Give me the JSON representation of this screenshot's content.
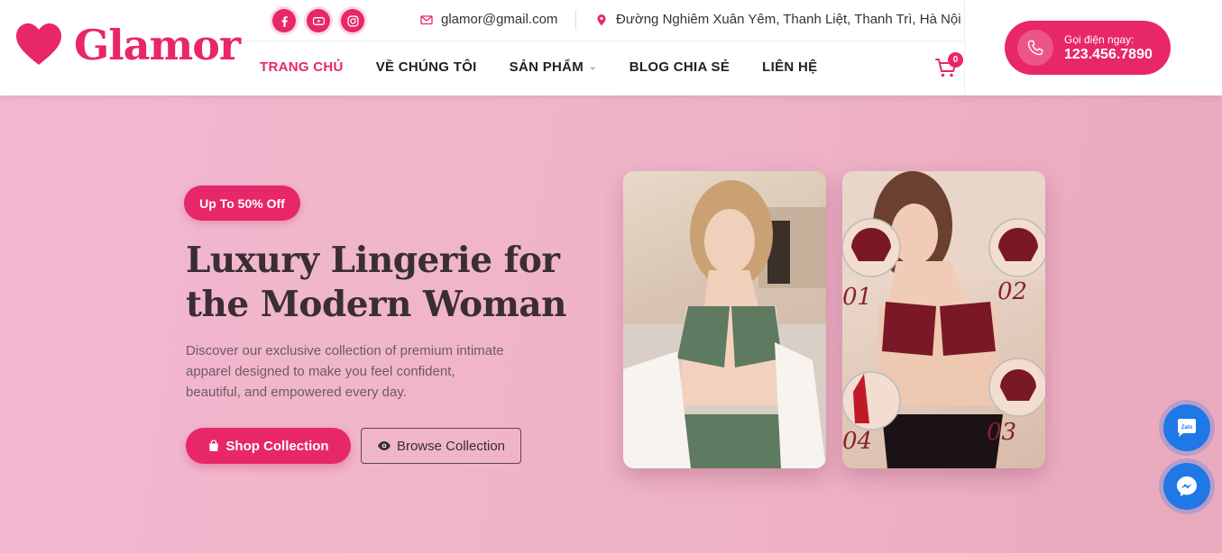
{
  "brand": {
    "name": "Glamor",
    "accent": "#e8266a"
  },
  "header": {
    "socials": [
      {
        "icon": "facebook-icon"
      },
      {
        "icon": "youtube-icon"
      },
      {
        "icon": "instagram-icon"
      }
    ],
    "email": "glamor@gmail.com",
    "address": "Đường Nghiêm Xuân Yêm, Thanh Liệt, Thanh Trì, Hà Nội",
    "nav": [
      {
        "label": "TRANG CHỦ",
        "active": true
      },
      {
        "label": "VỀ CHÚNG TÔI"
      },
      {
        "label": "SẢN PHẨM",
        "has_dropdown": true
      },
      {
        "label": "BLOG CHIA SẺ"
      },
      {
        "label": "LIÊN HỆ"
      }
    ],
    "cart_count": "0",
    "call": {
      "label": "Gọi điện ngay:",
      "number": "123.456.7890"
    }
  },
  "hero": {
    "badge": "Up To 50% Off",
    "title": "Luxury Lingerie for the Modern Woman",
    "description": "Discover our exclusive collection of premium intimate apparel designed to make you feel confident, beautiful, and empowered every day.",
    "primary_button": "Shop Collection",
    "secondary_button": "Browse Collection",
    "photo_labels": [
      "01",
      "02",
      "03",
      "04"
    ]
  },
  "floating": {
    "zalo_label": "Zalo"
  }
}
